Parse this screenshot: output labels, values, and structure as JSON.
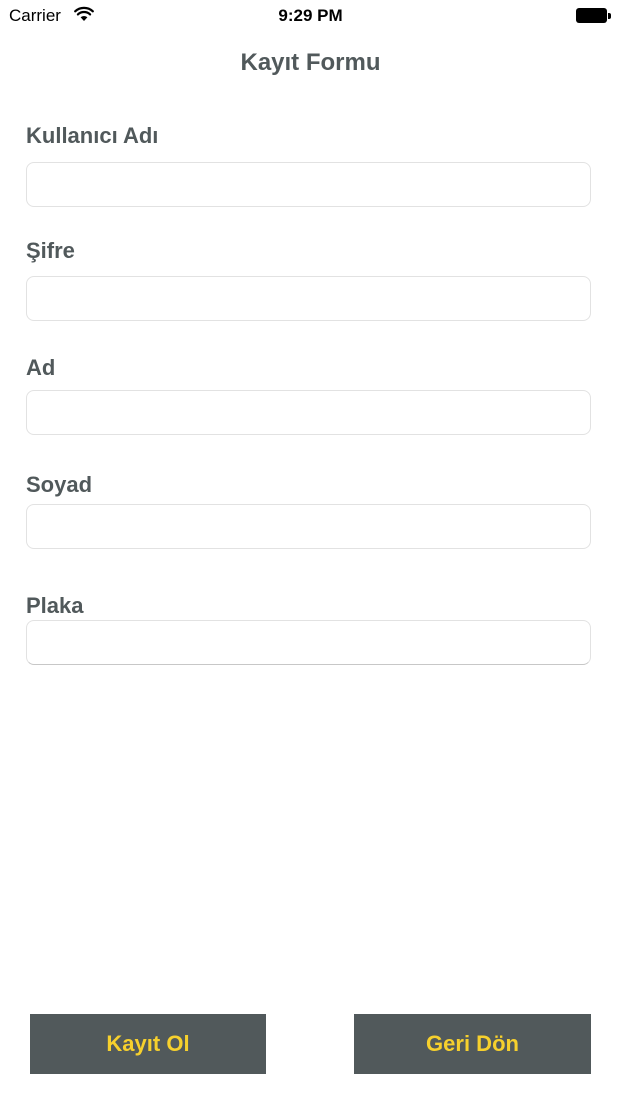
{
  "status_bar": {
    "carrier": "Carrier",
    "wifi_icon": "wifi-icon",
    "time": "9:29 PM",
    "battery_icon": "battery-icon"
  },
  "form": {
    "title": "Kayıt Formu",
    "fields": [
      {
        "label": "Kullanıcı Adı",
        "value": "",
        "placeholder": ""
      },
      {
        "label": "Şifre",
        "value": "",
        "placeholder": ""
      },
      {
        "label": "Ad",
        "value": "",
        "placeholder": ""
      },
      {
        "label": "Soyad",
        "value": "",
        "placeholder": ""
      },
      {
        "label": "Plaka",
        "value": "",
        "placeholder": ""
      }
    ]
  },
  "buttons": {
    "register_label": "Kayıt Ol",
    "back_label": "Geri Dön"
  },
  "colors": {
    "text": "#51595b",
    "button_background": "#51595b",
    "button_text": "#f6d02d",
    "input_border": "#e2e2e2"
  }
}
